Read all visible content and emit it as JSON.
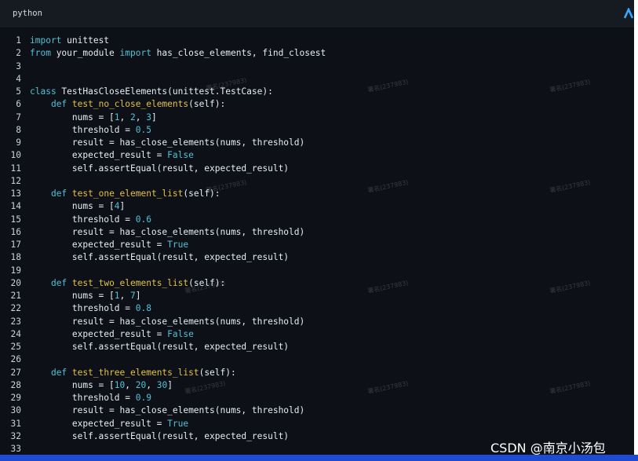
{
  "header": {
    "language": "python",
    "corner_icon": "chevron-up-icon"
  },
  "colors": {
    "background": "#0d1117",
    "keyword": "#4fc1d6",
    "function": "#e2c044",
    "number": "#4fc1d6",
    "text": "#e6edf3"
  },
  "code": [
    {
      "n": "1",
      "tokens": [
        {
          "t": "import",
          "c": "kw"
        },
        {
          "t": " unittest",
          "c": "txt"
        }
      ]
    },
    {
      "n": "2",
      "tokens": [
        {
          "t": "from",
          "c": "kw"
        },
        {
          "t": " your_module ",
          "c": "txt"
        },
        {
          "t": "import",
          "c": "kw"
        },
        {
          "t": " has_close_elements, find_closest",
          "c": "txt"
        }
      ]
    },
    {
      "n": "3",
      "tokens": []
    },
    {
      "n": "4",
      "tokens": []
    },
    {
      "n": "5",
      "tokens": [
        {
          "t": "class",
          "c": "kw"
        },
        {
          "t": " TestHasCloseElements(unittest.TestCase):",
          "c": "txt"
        }
      ]
    },
    {
      "n": "6",
      "tokens": [
        {
          "t": "    ",
          "c": "txt"
        },
        {
          "t": "def",
          "c": "kw"
        },
        {
          "t": " ",
          "c": "txt"
        },
        {
          "t": "test_no_close_elements",
          "c": "fn"
        },
        {
          "t": "(self):",
          "c": "txt"
        }
      ]
    },
    {
      "n": "7",
      "tokens": [
        {
          "t": "        nums = [",
          "c": "txt"
        },
        {
          "t": "1",
          "c": "num"
        },
        {
          "t": ", ",
          "c": "txt"
        },
        {
          "t": "2",
          "c": "num"
        },
        {
          "t": ", ",
          "c": "txt"
        },
        {
          "t": "3",
          "c": "num"
        },
        {
          "t": "]",
          "c": "txt"
        }
      ]
    },
    {
      "n": "8",
      "tokens": [
        {
          "t": "        threshold = ",
          "c": "txt"
        },
        {
          "t": "0.5",
          "c": "num"
        }
      ]
    },
    {
      "n": "9",
      "tokens": [
        {
          "t": "        result = has_close_elements(nums, threshold)",
          "c": "txt"
        }
      ]
    },
    {
      "n": "10",
      "tokens": [
        {
          "t": "        expected_result = ",
          "c": "txt"
        },
        {
          "t": "False",
          "c": "cst"
        }
      ]
    },
    {
      "n": "11",
      "tokens": [
        {
          "t": "        self.assertEqual(result, expected_result)",
          "c": "txt"
        }
      ]
    },
    {
      "n": "12",
      "tokens": []
    },
    {
      "n": "13",
      "tokens": [
        {
          "t": "    ",
          "c": "txt"
        },
        {
          "t": "def",
          "c": "kw"
        },
        {
          "t": " ",
          "c": "txt"
        },
        {
          "t": "test_one_element_list",
          "c": "fn"
        },
        {
          "t": "(self):",
          "c": "txt"
        }
      ]
    },
    {
      "n": "14",
      "tokens": [
        {
          "t": "        nums = [",
          "c": "txt"
        },
        {
          "t": "4",
          "c": "num"
        },
        {
          "t": "]",
          "c": "txt"
        }
      ]
    },
    {
      "n": "15",
      "tokens": [
        {
          "t": "        threshold = ",
          "c": "txt"
        },
        {
          "t": "0.6",
          "c": "num"
        }
      ]
    },
    {
      "n": "16",
      "tokens": [
        {
          "t": "        result = has_close_elements(nums, threshold)",
          "c": "txt"
        }
      ]
    },
    {
      "n": "17",
      "tokens": [
        {
          "t": "        expected_result = ",
          "c": "txt"
        },
        {
          "t": "True",
          "c": "cst"
        }
      ]
    },
    {
      "n": "18",
      "tokens": [
        {
          "t": "        self.assertEqual(result, expected_result)",
          "c": "txt"
        }
      ]
    },
    {
      "n": "19",
      "tokens": []
    },
    {
      "n": "20",
      "tokens": [
        {
          "t": "    ",
          "c": "txt"
        },
        {
          "t": "def",
          "c": "kw"
        },
        {
          "t": " ",
          "c": "txt"
        },
        {
          "t": "test_two_elements_list",
          "c": "fn"
        },
        {
          "t": "(self):",
          "c": "txt"
        }
      ]
    },
    {
      "n": "21",
      "tokens": [
        {
          "t": "        nums = [",
          "c": "txt"
        },
        {
          "t": "1",
          "c": "num"
        },
        {
          "t": ", ",
          "c": "txt"
        },
        {
          "t": "7",
          "c": "num"
        },
        {
          "t": "]",
          "c": "txt"
        }
      ]
    },
    {
      "n": "22",
      "tokens": [
        {
          "t": "        threshold = ",
          "c": "txt"
        },
        {
          "t": "0.8",
          "c": "num"
        }
      ]
    },
    {
      "n": "23",
      "tokens": [
        {
          "t": "        result = has_close_elements(nums, threshold)",
          "c": "txt"
        }
      ]
    },
    {
      "n": "24",
      "tokens": [
        {
          "t": "        expected_result = ",
          "c": "txt"
        },
        {
          "t": "False",
          "c": "cst"
        }
      ]
    },
    {
      "n": "25",
      "tokens": [
        {
          "t": "        self.assertEqual(result, expected_result)",
          "c": "txt"
        }
      ]
    },
    {
      "n": "26",
      "tokens": []
    },
    {
      "n": "27",
      "tokens": [
        {
          "t": "    ",
          "c": "txt"
        },
        {
          "t": "def",
          "c": "kw"
        },
        {
          "t": " ",
          "c": "txt"
        },
        {
          "t": "test_three_elements_list",
          "c": "fn"
        },
        {
          "t": "(self):",
          "c": "txt"
        }
      ]
    },
    {
      "n": "28",
      "tokens": [
        {
          "t": "        nums = [",
          "c": "txt"
        },
        {
          "t": "10",
          "c": "num"
        },
        {
          "t": ", ",
          "c": "txt"
        },
        {
          "t": "20",
          "c": "num"
        },
        {
          "t": ", ",
          "c": "txt"
        },
        {
          "t": "30",
          "c": "num"
        },
        {
          "t": "]",
          "c": "txt"
        }
      ]
    },
    {
      "n": "29",
      "tokens": [
        {
          "t": "        threshold = ",
          "c": "txt"
        },
        {
          "t": "0.9",
          "c": "num"
        }
      ]
    },
    {
      "n": "30",
      "tokens": [
        {
          "t": "        result = has_close_elements(nums, threshold)",
          "c": "txt"
        }
      ]
    },
    {
      "n": "31",
      "tokens": [
        {
          "t": "        expected_result = ",
          "c": "txt"
        },
        {
          "t": "True",
          "c": "cst"
        }
      ]
    },
    {
      "n": "32",
      "tokens": [
        {
          "t": "        self.assertEqual(result, expected_result)",
          "c": "txt"
        }
      ]
    },
    {
      "n": "33",
      "tokens": []
    }
  ],
  "watermark": "CSDN @南京小汤包",
  "faint_watermark": "署名(237983)"
}
